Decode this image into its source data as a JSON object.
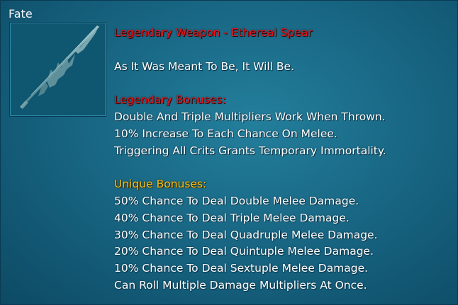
{
  "item": {
    "name": "Fate",
    "icon": "spear-icon",
    "type_line": "Legendary Weapon - Ethereal Spear",
    "flavor": "As It Was Meant To Be, It Will Be."
  },
  "legendary": {
    "heading": "Legendary Bonuses:",
    "lines": [
      "Double And Triple Multipliers Work When Thrown.",
      "10% Increase To Each Chance On Melee.",
      "Triggering All Crits Grants Temporary Immortality."
    ]
  },
  "unique": {
    "heading": "Unique Bonuses:",
    "lines": [
      "50% Chance To Deal Double Melee Damage.",
      "40% Chance To Deal Triple Melee Damage.",
      "30% Chance To Deal Quadruple Melee Damage.",
      "20% Chance To Deal Quintuple Melee Damage.",
      "10% Chance To Deal Sextuple Melee Damage.",
      "Can Roll Multiple Damage Multipliers At Once."
    ]
  },
  "colors": {
    "background": "#16627f",
    "legendary_red": "#f2131a",
    "unique_gold": "#f6c21a",
    "text": "#ffffff"
  }
}
